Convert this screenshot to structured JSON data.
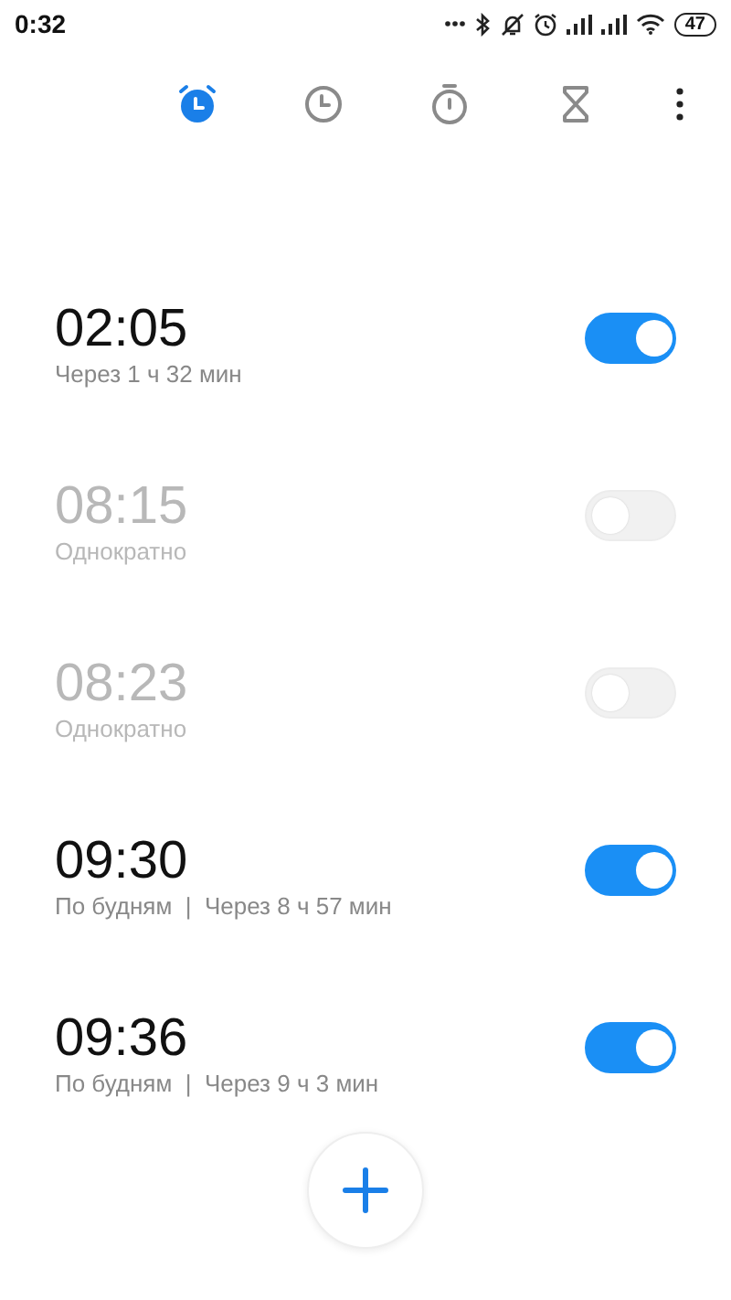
{
  "status_bar": {
    "time": "0:32",
    "battery": "47"
  },
  "tabs": [
    {
      "kind": "alarm",
      "selected": true
    },
    {
      "kind": "clock",
      "selected": false
    },
    {
      "kind": "stopwatch",
      "selected": false
    },
    {
      "kind": "timer",
      "selected": false
    }
  ],
  "alarms": [
    {
      "time": "02:05",
      "subtitle": "Через 1 ч 32 мин",
      "on": true
    },
    {
      "time": "08:15",
      "subtitle": "Однократно",
      "on": false
    },
    {
      "time": "08:23",
      "subtitle": "Однократно",
      "on": false
    },
    {
      "time": "09:30",
      "subtitle": "По будням  |  Через 8 ч 57 мин",
      "on": true
    },
    {
      "time": "09:36",
      "subtitle": "По будням  |  Через 9 ч 3 мин",
      "on": true
    }
  ]
}
